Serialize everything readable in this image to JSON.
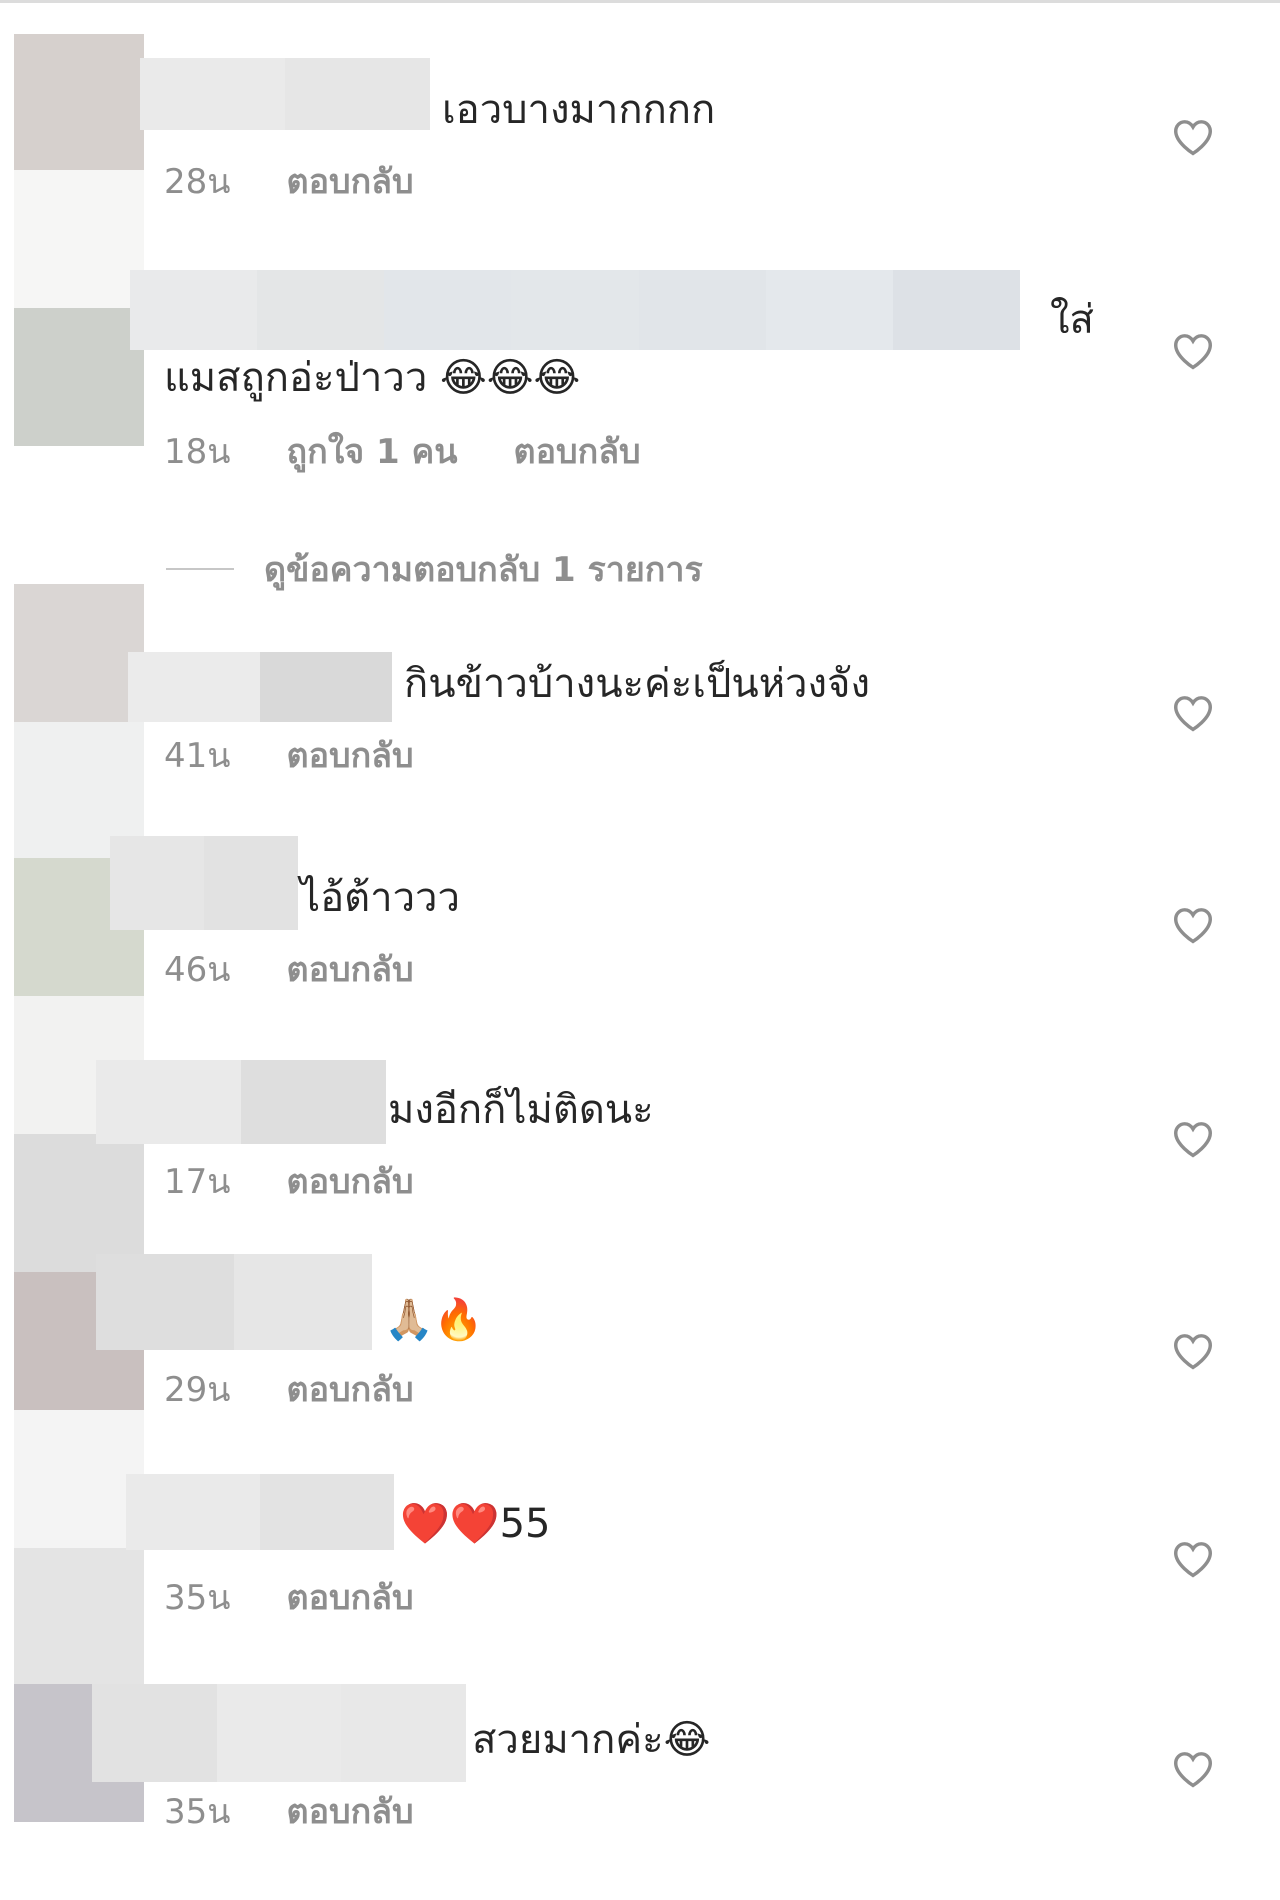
{
  "comments": [
    {
      "text": "เอวบางมากกกก",
      "time": "28น",
      "reply": "ตอบกลับ"
    },
    {
      "text_tail": "ใส่",
      "text": "แมสถูกอ่ะป่าวว 😂😂😂",
      "time": "18น",
      "likes": "ถูกใจ 1 คน",
      "reply": "ตอบกลับ"
    },
    {
      "text": "กินข้าวบ้างนะค่ะเป็นห่วงจัง",
      "time": "41น",
      "reply": "ตอบกลับ"
    },
    {
      "text": "ไอ้ต้าววว",
      "time": "46น",
      "reply": "ตอบกลับ"
    },
    {
      "text": "มงอีกก็ไม่ติดนะ",
      "time": "17น",
      "reply": "ตอบกลับ"
    },
    {
      "text": "🙏🏼🔥",
      "time": "29น",
      "reply": "ตอบกลับ"
    },
    {
      "text": "❤️❤️55",
      "time": "35น",
      "reply": "ตอบกลับ"
    },
    {
      "text": "สวยมากค่ะ😂",
      "time": "35น",
      "reply": "ตอบกลับ"
    }
  ],
  "view_replies": "ดูข้อความตอบกลับ 1 รายการ",
  "icons": {
    "like": "heart-outline-icon"
  },
  "colors": {
    "text": "#262626",
    "meta": "#8e8e8e",
    "divider": "#c7c7c7"
  }
}
